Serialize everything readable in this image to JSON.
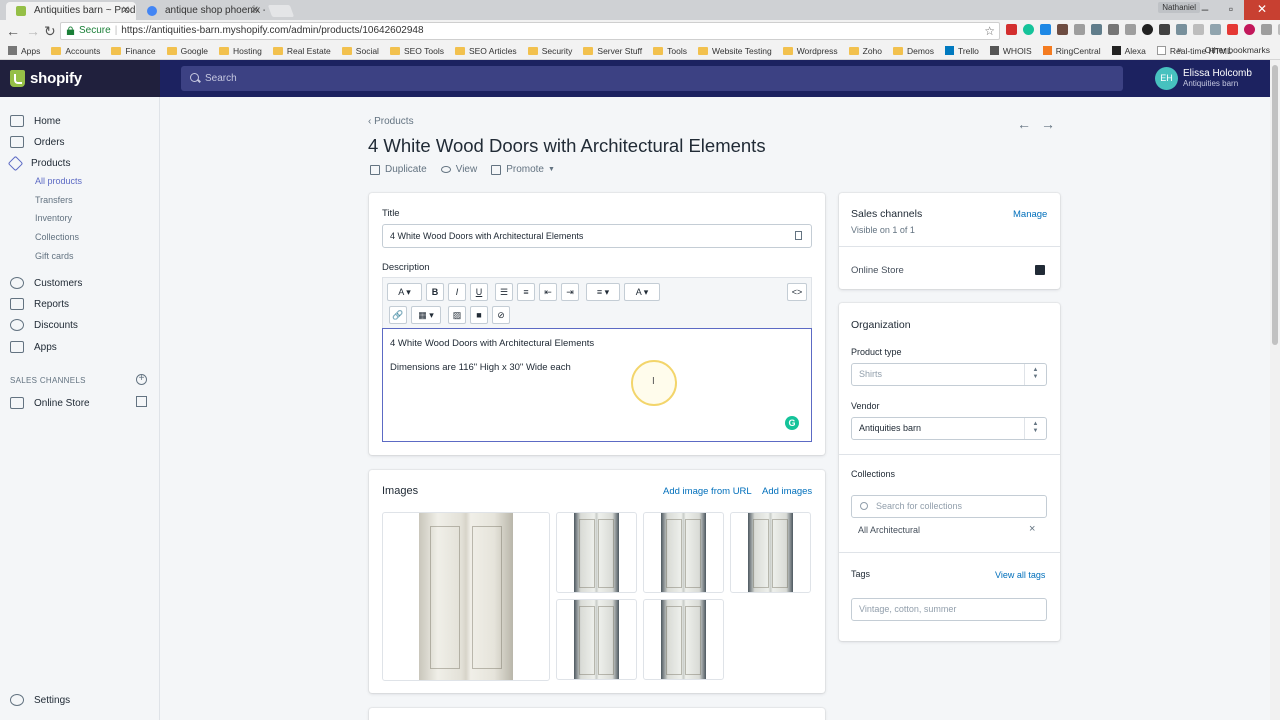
{
  "browser": {
    "tabs": [
      {
        "title": "Antiquities barn ~ Produ",
        "icon_color": "#95bf47"
      },
      {
        "title": "antique shop phoenix - ",
        "icon_color": "#4285f4"
      }
    ],
    "profile": "Nathaniel",
    "secure_label": "Secure",
    "url": "https://antiquities-barn.myshopify.com/admin/products/10642602948",
    "bookmarks": [
      "Apps",
      "Accounts",
      "Finance",
      "Google",
      "Hosting",
      "Real Estate",
      "Social",
      "SEO Tools",
      "SEO Articles",
      "Security",
      "Server Stuff",
      "Tools",
      "Website Testing",
      "Wordpress",
      "Zoho",
      "Demos",
      "Trello",
      "WHOIS",
      "RingCentral",
      "Alexa",
      "Real-time HTML"
    ],
    "more_bookmarks": "»",
    "other_bookmarks": "Other bookmarks"
  },
  "topbar": {
    "brand": "shopify",
    "search_placeholder": "Search",
    "user_initials": "EH",
    "user_name": "Elissa Holcomb",
    "store_name": "Antiquities barn"
  },
  "sidebar": {
    "items": [
      "Home",
      "Orders",
      "Products"
    ],
    "product_sub": [
      "All products",
      "Transfers",
      "Inventory",
      "Collections",
      "Gift cards"
    ],
    "items2": [
      "Customers",
      "Reports",
      "Discounts",
      "Apps"
    ],
    "sales_channels_heading": "SALES CHANNELS",
    "online_store": "Online Store",
    "settings": "Settings"
  },
  "page": {
    "breadcrumb": "Products",
    "title": "4 White Wood Doors with Architectural Elements",
    "actions": [
      "Duplicate",
      "View",
      "Promote"
    ]
  },
  "product_form": {
    "title_label": "Title",
    "title_value": "4 White Wood Doors with Architectural Elements",
    "description_label": "Description",
    "description_lines": [
      "4 White Wood Doors with Architectural Elements",
      "Dimensions are 116\" High x 30\" Wide each"
    ],
    "html_toggle": "<>"
  },
  "images": {
    "heading": "Images",
    "add_from_url": "Add image from URL",
    "add_images": "Add images"
  },
  "sales_channels": {
    "heading": "Sales channels",
    "manage": "Manage",
    "visible": "Visible on 1 of 1",
    "online_store": "Online Store"
  },
  "organization": {
    "heading": "Organization",
    "product_type_label": "Product type",
    "product_type_value": "Shirts",
    "vendor_label": "Vendor",
    "vendor_value": "Antiquities barn",
    "collections_label": "Collections",
    "collections_placeholder": "Search for collections",
    "collection_tag": "All Architectural",
    "remove": "×",
    "tags_label": "Tags",
    "view_all_tags": "View all tags",
    "tags_placeholder": "Vintage, cotton, summer"
  }
}
